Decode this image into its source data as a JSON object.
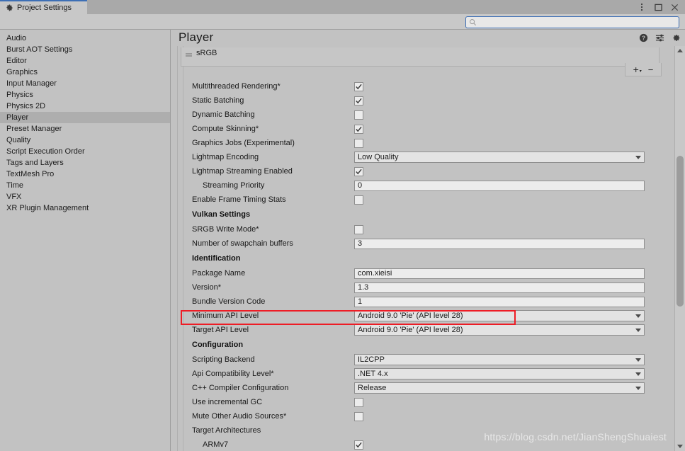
{
  "window": {
    "tab_label": "Project Settings",
    "tab_icon": "gear-icon",
    "controls": {
      "menu": "kebab-menu-icon",
      "maximize": "maximize-icon",
      "close": "close-icon"
    }
  },
  "search": {
    "icon": "search-icon",
    "value": "",
    "placeholder": ""
  },
  "sidebar": {
    "items": [
      {
        "label": "Audio",
        "selected": false
      },
      {
        "label": "Burst AOT Settings",
        "selected": false
      },
      {
        "label": "Editor",
        "selected": false
      },
      {
        "label": "Graphics",
        "selected": false
      },
      {
        "label": "Input Manager",
        "selected": false
      },
      {
        "label": "Physics",
        "selected": false
      },
      {
        "label": "Physics 2D",
        "selected": false
      },
      {
        "label": "Player",
        "selected": true
      },
      {
        "label": "Preset Manager",
        "selected": false
      },
      {
        "label": "Quality",
        "selected": false
      },
      {
        "label": "Script Execution Order",
        "selected": false
      },
      {
        "label": "Tags and Layers",
        "selected": false
      },
      {
        "label": "TextMesh Pro",
        "selected": false
      },
      {
        "label": "Time",
        "selected": false
      },
      {
        "label": "VFX",
        "selected": false
      },
      {
        "label": "XR Plugin Management",
        "selected": false
      }
    ]
  },
  "panel": {
    "title": "Player",
    "header_icons": [
      {
        "name": "help-icon"
      },
      {
        "name": "preset-icon"
      },
      {
        "name": "settings-gear-icon"
      }
    ],
    "srgb": {
      "handle_icon": "drag-handle-icon",
      "label": "sRGB",
      "add_button": "+",
      "add_caret": "▾",
      "remove_button": "−"
    },
    "rows": [
      {
        "type": "checkbox",
        "label": "Multithreaded Rendering*",
        "checked": true
      },
      {
        "type": "checkbox",
        "label": "Static Batching",
        "checked": true
      },
      {
        "type": "checkbox",
        "label": "Dynamic Batching",
        "checked": false
      },
      {
        "type": "checkbox",
        "label": "Compute Skinning*",
        "checked": true
      },
      {
        "type": "checkbox",
        "label": "Graphics Jobs (Experimental)",
        "checked": false
      },
      {
        "type": "dropdown",
        "label": "Lightmap Encoding",
        "value": "Low Quality"
      },
      {
        "type": "checkbox",
        "label": "Lightmap Streaming Enabled",
        "checked": true
      },
      {
        "type": "text",
        "label": "Streaming Priority",
        "value": "0",
        "indent": true
      },
      {
        "type": "checkbox",
        "label": "Enable Frame Timing Stats",
        "checked": false
      },
      {
        "type": "section",
        "label": "Vulkan Settings"
      },
      {
        "type": "checkbox",
        "label": "SRGB Write Mode*",
        "checked": false
      },
      {
        "type": "text",
        "label": "Number of swapchain buffers",
        "value": "3"
      },
      {
        "type": "section",
        "label": "Identification"
      },
      {
        "type": "text",
        "label": "Package Name",
        "value": "com.xieisi",
        "highlighted": true
      },
      {
        "type": "text",
        "label": "Version*",
        "value": "1.3"
      },
      {
        "type": "text",
        "label": "Bundle Version Code",
        "value": "1"
      },
      {
        "type": "dropdown",
        "label": "Minimum API Level",
        "value": "Android 9.0 'Pie' (API level 28)"
      },
      {
        "type": "dropdown",
        "label": "Target API Level",
        "value": "Android 9.0 'Pie' (API level 28)"
      },
      {
        "type": "section",
        "label": "Configuration"
      },
      {
        "type": "dropdown",
        "label": "Scripting Backend",
        "value": "IL2CPP"
      },
      {
        "type": "dropdown",
        "label": "Api Compatibility Level*",
        "value": ".NET 4.x"
      },
      {
        "type": "dropdown",
        "label": "C++ Compiler Configuration",
        "value": "Release"
      },
      {
        "type": "checkbox",
        "label": "Use incremental GC",
        "checked": false
      },
      {
        "type": "checkbox",
        "label": "Mute Other Audio Sources*",
        "checked": false
      },
      {
        "type": "label",
        "label": "Target Architectures"
      },
      {
        "type": "checkbox",
        "label": "ARMv7",
        "checked": true,
        "indent": true
      }
    ],
    "scrollbar": {
      "up_arrow": "scroll-up-icon",
      "down_arrow": "scroll-down-icon"
    }
  },
  "watermark": "https://blog.csdn.net/JianShengShuaiest",
  "colors": {
    "accent": "#3d6fb5",
    "highlight": "#ee1c25",
    "panel_bg": "#c2c2c2",
    "field_bg": "#ececec"
  }
}
